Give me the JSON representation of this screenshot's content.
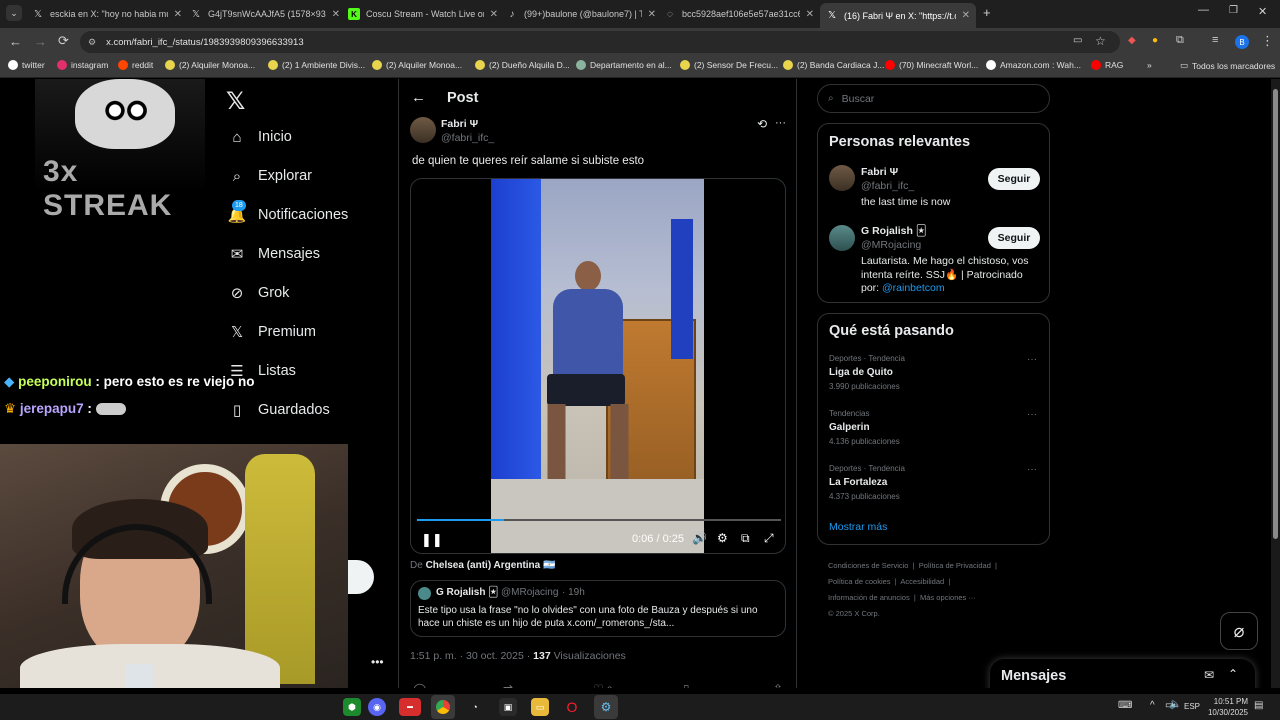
{
  "browser": {
    "tabs": [
      {
        "title": "esckia en X: \"hoy no habia muc",
        "icon": "x-logo-icon"
      },
      {
        "title": "G4jT9snWcAAJfA5 (1578×934)",
        "icon": "x-logo-icon"
      },
      {
        "title": "Coscu Stream - Watch Live on K",
        "icon": "kick-icon"
      },
      {
        "title": "(99+)baulone (@baulone7) | Tik",
        "icon": "tiktok-icon"
      },
      {
        "title": "bcc5928aef106e5e57ae31cc682",
        "icon": "globe-icon"
      },
      {
        "title": "(16) Fabri Ψ en X: \"https://t.co/",
        "icon": "x-logo-icon"
      }
    ],
    "url": "x.com/fabri_ifc_/status/1983939809396633913",
    "bookmarks": [
      {
        "label": "twitter",
        "color": "#ffffff"
      },
      {
        "label": "instagram",
        "color": "#e1306c"
      },
      {
        "label": "reddit",
        "color": "#ff4500"
      },
      {
        "label": "(2) Alquiler Monoa...",
        "color": "#e8d44d"
      },
      {
        "label": "(2) 1 Ambiente Divis...",
        "color": "#e8d44d"
      },
      {
        "label": "(2) Alquiler Monoa...",
        "color": "#e8d44d"
      },
      {
        "label": "(2) Dueño Alquila D...",
        "color": "#e8d44d"
      },
      {
        "label": "Departamento en al...",
        "color": "#8ab4a0"
      },
      {
        "label": "(2) Sensor De Frecu...",
        "color": "#e8d44d"
      },
      {
        "label": "(2) Banda Cardiaca J...",
        "color": "#e8d44d"
      },
      {
        "label": "(70) Minecraft Worl...",
        "color": "#ff0000"
      },
      {
        "label": "Amazon.com : Wah...",
        "color": "#ffffff"
      },
      {
        "label": "RAG",
        "color": "#ff0000"
      }
    ],
    "all_bookmarks": "Todos los marcadores",
    "profile_letter": "B"
  },
  "overlay": {
    "streak_text": "3x STREAK",
    "chat": [
      {
        "user": "peeponirou",
        "msg": ": pero esto es re viejo no",
        "color": "#c7ff5a"
      },
      {
        "user": "jerepapu7",
        "msg": ":",
        "color": "#b9a5ff"
      }
    ]
  },
  "sidebar": {
    "items": [
      {
        "label": "Inicio",
        "icon": "home-icon"
      },
      {
        "label": "Explorar",
        "icon": "search-icon"
      },
      {
        "label": "Notificaciones",
        "icon": "bell-icon",
        "badge": "18"
      },
      {
        "label": "Mensajes",
        "icon": "mail-icon"
      },
      {
        "label": "Grok",
        "icon": "grok-icon"
      },
      {
        "label": "Premium",
        "icon": "x-logo-icon"
      },
      {
        "label": "Listas",
        "icon": "list-icon"
      },
      {
        "label": "Guardados",
        "icon": "bookmark-icon"
      }
    ]
  },
  "post": {
    "header": "Post",
    "author_name": "Fabri Ψ",
    "author_handle": "@fabri_ifc_",
    "text": "de quien te queres reír salame si subiste esto",
    "video_time": "0:06 / 0:25",
    "video_progress": 0.24,
    "source_prefix": "De",
    "source_name": "Chelsea (anti) Argentina 🇦🇷",
    "quote": {
      "name": "G Rojalish 🃏",
      "handle": "@MRojacing",
      "time": "· 19h",
      "text": "Este tipo usa la frase \"no lo olvides\" con una foto de Bauza y después si uno hace un chiste es un hijo de puta x.com/_romerons_/sta..."
    },
    "timestamp": "1:51 p. m. · 30 oct. 2025 ·",
    "views_count": "137",
    "views_label": "Visualizaciones",
    "likes": "3"
  },
  "right": {
    "search_placeholder": "Buscar",
    "relevant_title": "Personas relevantes",
    "people": [
      {
        "name": "Fabri Ψ",
        "handle": "@fabri_ifc_",
        "bio": "the last time is now",
        "button": "Seguir"
      },
      {
        "name": "G Rojalish 🃏",
        "handle": "@MRojacing",
        "bio": "Lautarista. Me hago el chistoso, vos intenta reírte. SSJ🔥 | Patrocinado por:",
        "bio_link": "@rainbetcom",
        "button": "Seguir"
      }
    ],
    "trends_title": "Qué está pasando",
    "trends": [
      {
        "context": "Deportes · Tendencia",
        "name": "Liga de Quito",
        "count": "3.990 publicaciones"
      },
      {
        "context": "Tendencias",
        "name": "Galperin",
        "count": "4.136 publicaciones"
      },
      {
        "context": "Deportes · Tendencia",
        "name": "La Fortaleza",
        "count": "4.373 publicaciones"
      }
    ],
    "show_more": "Mostrar más",
    "footer": [
      "Condiciones de Servicio",
      "Política de Privacidad",
      "Política de cookies",
      "Accesibilidad",
      "Información de anuncios",
      "Más opciones ···",
      "© 2025 X Corp."
    ],
    "messages_title": "Mensajes"
  },
  "taskbar": {
    "lang": "ESP",
    "time": "10:51 PM",
    "date": "10/30/2025"
  },
  "colors": {
    "accent": "#1d9bf0",
    "bg": "#000000",
    "border": "#2f3336",
    "muted": "#71767b"
  }
}
